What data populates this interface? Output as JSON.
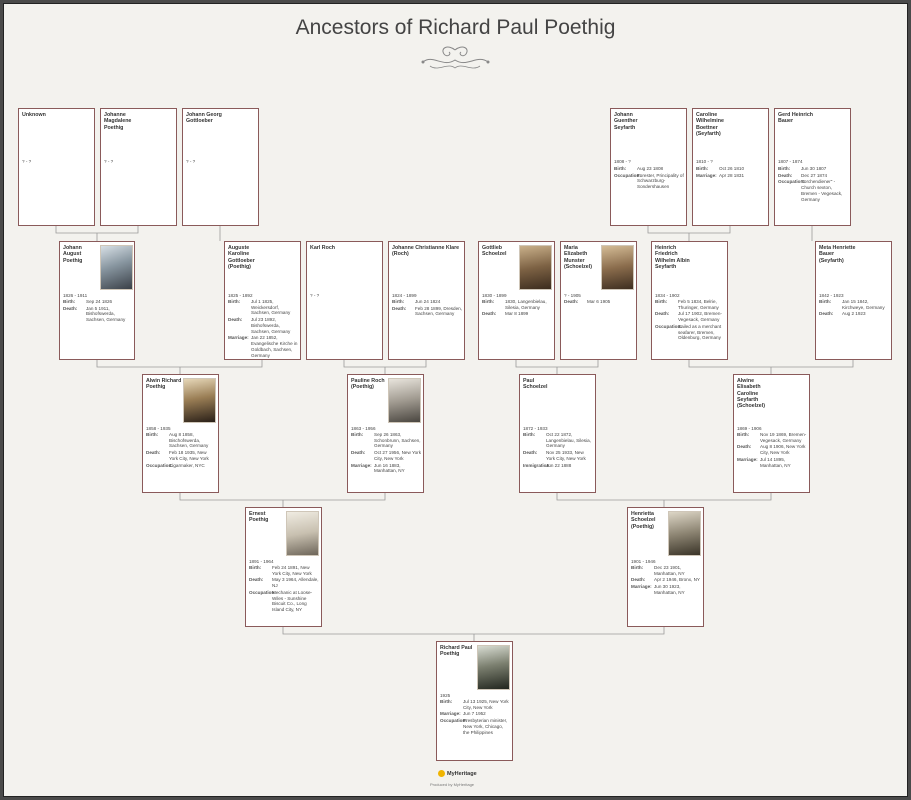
{
  "title": "Ancestors of Richard Paul Poethig",
  "labels": {
    "birth": "Birth:",
    "death": "Death:",
    "occupation": "Occupation:",
    "marriage": "Marriage:",
    "immigration": "Immigration:"
  },
  "gen1": [
    {
      "name": "Unknown",
      "years": "? - ?"
    },
    {
      "name": "Johanne Magdalene Poethig",
      "years": "? - ?"
    },
    {
      "name": "Johann Georg Gottloeber",
      "years": "? - ?"
    },
    {
      "name": "Johann Guenther Seyfarth",
      "years": "1808 - ?",
      "birth": "Aug 23 1808",
      "occupation": "Forester, Principality of Schwarzburg-Sondershausen"
    },
    {
      "name": "Caroline Wilhelmine Boettner (Seyfarth)",
      "years": "1810 - ?",
      "birth": "Oct 26 1810",
      "marriage": "Apr 28 1831"
    },
    {
      "name": "Gerd Heinrich Bauer",
      "years": "1807 - 1874",
      "birth": "Jun 30 1807",
      "death": "Dec 27 1874",
      "occupation": "\"torchendiener\" - Church sexton, Bremen - Vegesack, Germany"
    }
  ],
  "gen2": [
    {
      "name": "Johann August Poethig",
      "years": "1826 - 1911",
      "birth": "Sep 24 1826",
      "death": "Jan 5 1911, Bishofswerda, Sachsen, Germany"
    },
    {
      "name": "Auguste Karoline Gottloeber (Poethig)",
      "years": "1825 - 1892",
      "birth": "Jul 1 1825, Weickersdorf, Sachsen, Germany",
      "death": "Jul 23 1892, Bishofswerda, Sachsen, Germany",
      "marriage": "Jan 22 1852, Evangelische Kirche in Goldbach, Sachsen, Germany"
    },
    {
      "name": "Karl Roch",
      "years": "? - ?"
    },
    {
      "name": "Johanne Christianne Klare (Roch)",
      "years": "1824 - 1899",
      "birth": "Jun 24 1824",
      "death": "Feb 28 1899, Dresden, Sachsen, Germany"
    },
    {
      "name": "Gottlieb Schoelzel",
      "years": "1830 - 1899",
      "birth": "1830, Langenbielau, Silesia, Germany",
      "death": "Mar 8 1899"
    },
    {
      "name": "Maria Elizabeth Munster (Schoelzel)",
      "years": "? - 1905",
      "death": "Mar 6 1905"
    },
    {
      "name": "Heinrich Friedrich Wilhelm Albin Seyfarth",
      "years": "1834 - 1902",
      "birth": "Feb 5 1834, Belrie, Thuringer, Germany",
      "death": "Jul 17 1902, Bremen-Vegesack, Germany",
      "occupation": "Sailed as a merchant seafarer, Bremen, Oldenburg, Germany"
    },
    {
      "name": "Meta Henriette Bauer (Seyfarth)",
      "years": "1842 - 1923",
      "birth": "Jan 15 1842, Kirchweye, Germany",
      "death": "Aug 2 1923"
    }
  ],
  "gen3": [
    {
      "name": "Alwin Richard Poethig",
      "years": "1858 - 1935",
      "birth": "Aug 8 1858, Bischofswerda, Sachsen, Germany",
      "death": "Feb 18 1935, New York City, New York",
      "occupation": "Cigarmaker, NYC"
    },
    {
      "name": "Pauline Roch (Poethig)",
      "years": "1863 - 1956",
      "birth": "Sep 26 1863, Schonbrunn, Sachsen, Germany",
      "death": "Oct 27 1956, New York City, New York",
      "marriage": "Jun 16 1883, Manhattan, NY"
    },
    {
      "name": "Paul Schoelzel",
      "years": "1872 - 1933",
      "birth": "Oct 22 1872, Langenbielau, Silesia, Germany",
      "death": "Nov 25 1933, New York City, New York",
      "immigration": "Jun 22 1888"
    },
    {
      "name": "Alwine Elisabeth Caroline Seyfarth (Schoelzel)",
      "years": "1869 - 1906",
      "birth": "Nov 19 1869, Bremen-Vegesack, Germany",
      "death": "Aug 8 1906, New York City, New York",
      "marriage": "Jul 14 1895, Manhattan, NY"
    }
  ],
  "gen4": [
    {
      "name": "Ernest Poethig",
      "years": "1891 - 1964",
      "birth": "Feb 24 1891, New York City, New York",
      "death": "May 3 1964, Allendale, NJ",
      "occupation": "Mechanic at Loose-Wiles - Sunshine Biscuit Co., Long Island City, NY"
    },
    {
      "name": "Henrietta Schoelzel (Poethig)",
      "years": "1901 - 1946",
      "birth": "Dec 23 1901, Manhattan, NY",
      "death": "Apr 2 1946, Bronx, NY",
      "marriage": "Jun 30 1923, Manhattan, NY"
    }
  ],
  "gen5": [
    {
      "name": "Richard Paul Poethig",
      "years": "1925",
      "birth": "Jul 13 1925, New York City, New York",
      "marriage": "Jun 7 1952",
      "occupation": "Presbyterian minister, New York, Chicago, the Philippines"
    }
  ],
  "footer": {
    "logo_text": "MyHeritage",
    "produced": "Produced by MyHeritage"
  },
  "colors": {
    "background": "#f3f2ee",
    "card_border": "#8a5a5a",
    "connector": "#9a9a9a"
  }
}
